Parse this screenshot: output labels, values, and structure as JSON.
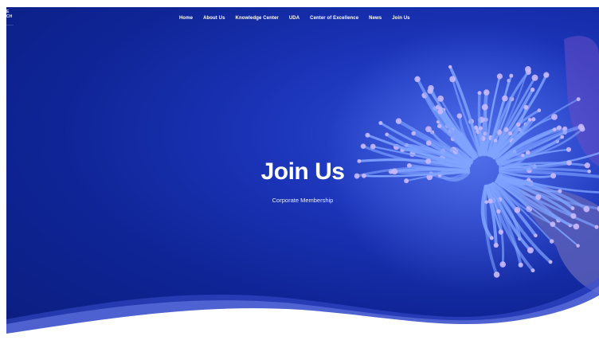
{
  "logo": {
    "line1": "E",
    "line2": "CH",
    "line3": "———"
  },
  "nav": {
    "items": [
      {
        "label": "Home"
      },
      {
        "label": "About Us"
      },
      {
        "label": "Knowledge Center"
      },
      {
        "label": "UDA"
      },
      {
        "label": "Center of Excellence"
      },
      {
        "label": "News"
      },
      {
        "label": "Join Us"
      }
    ]
  },
  "hero": {
    "title": "Join Us",
    "subtitle": "Corporate Membership",
    "background_image": "sea-anemone-photo"
  },
  "colors": {
    "hero_deep": "#0b1d7e",
    "hero_mid": "#1b34b8",
    "anemone_tentacle": "#7fa3ff",
    "anemone_tip": "#c9b8ff",
    "wave_band": "#5b6fe0",
    "page_bg": "#ffffff"
  }
}
